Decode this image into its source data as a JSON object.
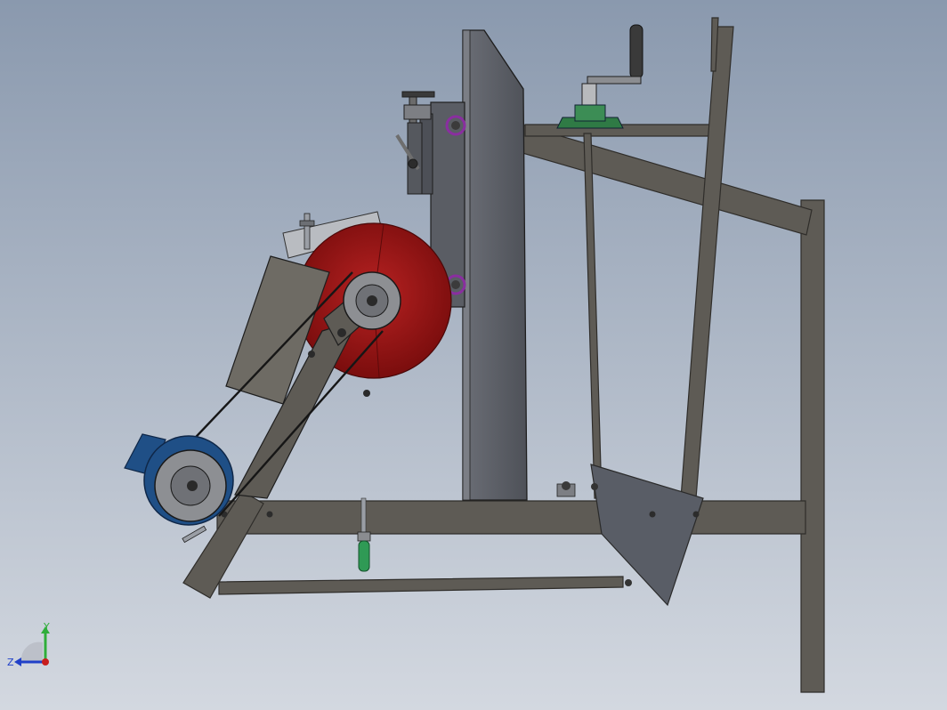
{
  "view": {
    "background_top": "#8a99ae",
    "background_bottom": "#d3d8e0"
  },
  "model": {
    "frame_color": "#5e5b55",
    "frame_edge": "#2f2d2a",
    "plate_color": "#5d6068",
    "blade_color": "#a11212",
    "motor_color": "#1f4f86",
    "bearing_color": "#2f7a45",
    "bolt_ring_color": "#8a2ea0",
    "handle_color": "#3a3a3a"
  },
  "triad": {
    "y_label": "Y",
    "z_label": "Z",
    "y_color": "#2fae3a",
    "z_color": "#2040c8",
    "origin_color": "#c81d1d"
  }
}
